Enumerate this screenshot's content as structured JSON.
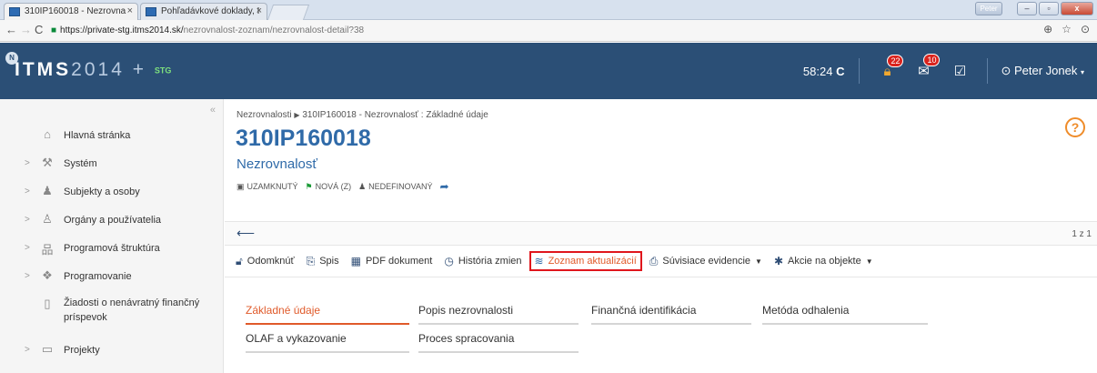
{
  "browser": {
    "tabs": [
      {
        "title": "310IP160018 - Nezrovna",
        "close": "×"
      },
      {
        "title": "Pohľadávkové doklady, I",
        "close": "×"
      }
    ],
    "window_user": "Peter",
    "url_host": "https://private-stg.itms2014.sk/",
    "url_path": "nezrovnalost-zoznam/nezrovnalost-detail?38"
  },
  "header": {
    "logo_letters": "ITMS",
    "logo_digits": "2014",
    "logo_plus": "+",
    "logo_env": "STG",
    "timer": "58:24",
    "lock_badge": "22",
    "mail_badge": "10",
    "user_name": "Peter Jonek"
  },
  "sidebar": {
    "items": [
      {
        "label": "Hlavná stránka",
        "icon": "home-icon",
        "chev": ""
      },
      {
        "label": "Systém",
        "icon": "wrench-icon",
        "chev": ">"
      },
      {
        "label": "Subjekty a osoby",
        "icon": "people-icon",
        "chev": ">"
      },
      {
        "label": "Orgány a používatelia",
        "icon": "users-list-icon",
        "chev": ">"
      },
      {
        "label": "Programová štruktúra",
        "icon": "sitemap-icon",
        "chev": ">"
      },
      {
        "label": "Programovanie",
        "icon": "cubes-icon",
        "chev": ">"
      },
      {
        "label": "Žiadosti o nenávratný finančný príspevok",
        "icon": "document-icon",
        "chev": ""
      },
      {
        "label": "Projekty",
        "icon": "folder-icon",
        "chev": ">"
      }
    ]
  },
  "main": {
    "breadcrumb_root": "Nezrovnalosti",
    "breadcrumb_sep": "▶",
    "breadcrumb_current": "310IP160018 - Nezrovnalosť : Základné údaje",
    "title": "310IP160018",
    "subtitle": "Nezrovnalosť",
    "status": [
      "UZAMKNUTÝ",
      "NOVÁ (Z)",
      "NEDEFINOVANÝ"
    ],
    "pager": "1 z 1",
    "toolbar": {
      "unlock": "Odomknúť",
      "file": "Spis",
      "pdf": "PDF dokument",
      "history": "História zmien",
      "updates": "Zoznam aktualizácií",
      "related": "Súvisiace evidencie",
      "actions": "Akcie na objekte"
    },
    "tabs": [
      "Základné údaje",
      "Popis nezrovnalosti",
      "Finančná identifikácia",
      "Metóda odhalenia",
      "OLAF a vykazovanie",
      "Proces spracovania"
    ]
  }
}
